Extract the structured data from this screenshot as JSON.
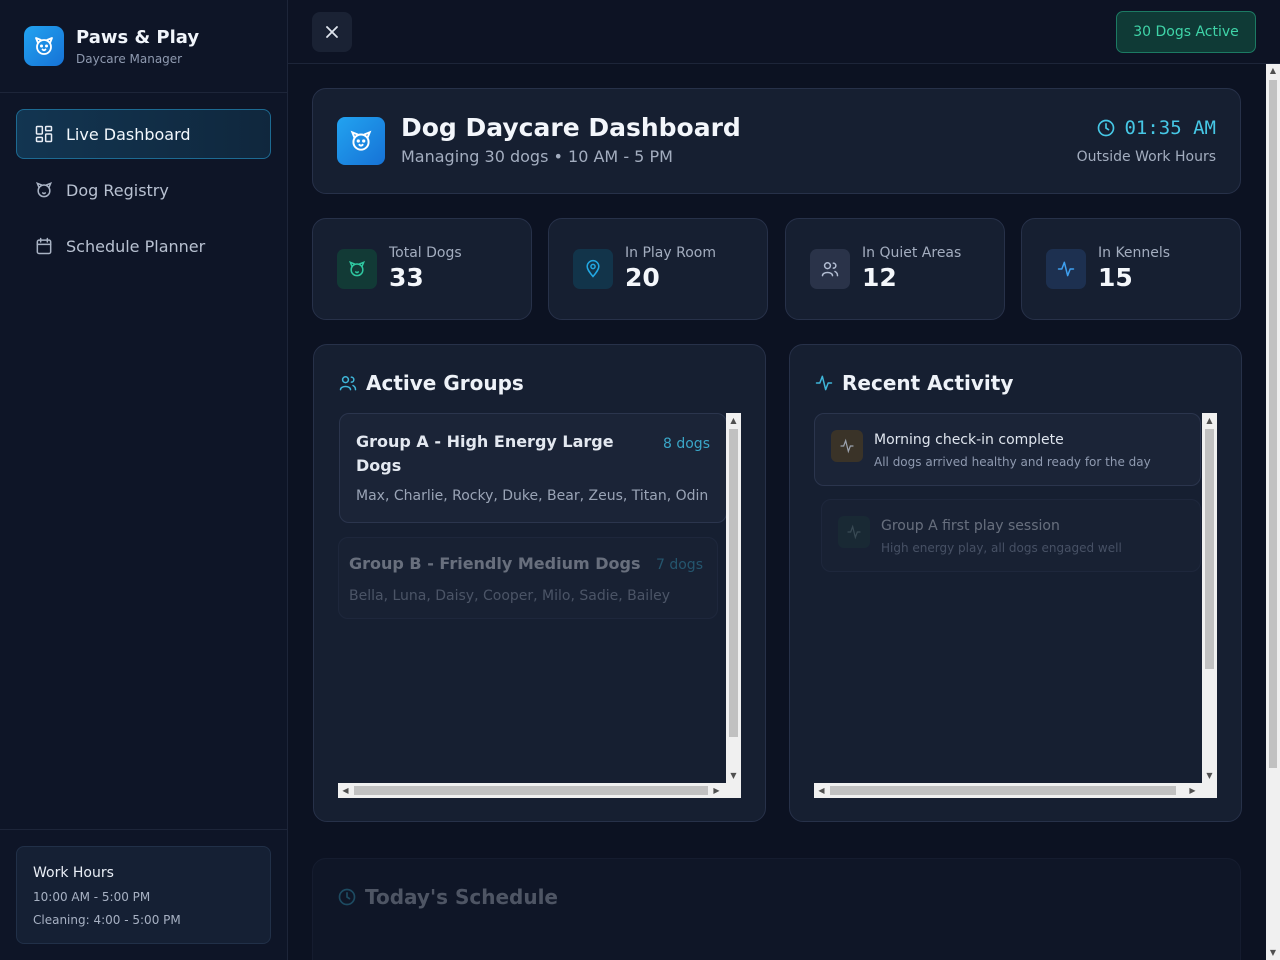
{
  "brand": {
    "title": "Paws & Play",
    "subtitle": "Daycare Manager",
    "logo_icon": "dog-icon"
  },
  "sidebar": {
    "items": [
      {
        "label": "Live Dashboard",
        "icon": "dashboard-grid-icon",
        "active": true
      },
      {
        "label": "Dog Registry",
        "icon": "dog-icon",
        "active": false
      },
      {
        "label": "Schedule Planner",
        "icon": "calendar-icon",
        "active": false
      }
    ],
    "work_hours": {
      "title": "Work Hours",
      "hours": "10:00 AM - 5:00 PM",
      "cleaning": "Cleaning: 4:00 - 5:00 PM"
    }
  },
  "topbar": {
    "close_icon": "close-icon",
    "active_badge": "30 Dogs Active"
  },
  "header": {
    "title": "Dog Daycare Dashboard",
    "subtitle": "Managing 30 dogs • 10 AM - 5 PM",
    "time": "01:35 AM",
    "status": "Outside Work Hours"
  },
  "stats": [
    {
      "label": "Total Dogs",
      "value": "33",
      "icon": "dog-icon",
      "color": "#2fc7a0"
    },
    {
      "label": "In Play Room",
      "value": "20",
      "icon": "map-pin-icon",
      "color": "#22a8e3"
    },
    {
      "label": "In Quiet Areas",
      "value": "12",
      "icon": "users-icon",
      "color": "#b2bdd2"
    },
    {
      "label": "In Kennels",
      "value": "15",
      "icon": "activity-icon",
      "color": "#3fa0f0"
    }
  ],
  "groups_panel": {
    "title": "Active Groups",
    "groups": [
      {
        "name": "Group A - High Energy Large Dogs",
        "count": "8 dogs",
        "dogs": "Max, Charlie, Rocky, Duke, Bear, Zeus, Titan, Odin"
      },
      {
        "name": "Group B - Friendly Medium Dogs",
        "count": "7 dogs",
        "dogs": "Bella, Luna, Daisy, Cooper, Milo, Sadie, Bailey"
      }
    ]
  },
  "activity_panel": {
    "title": "Recent Activity",
    "items": [
      {
        "title": "Morning check-in complete",
        "desc": "All dogs arrived healthy and ready for the day",
        "color": "#d49a3a"
      },
      {
        "title": "Group A first play session",
        "desc": "High energy play, all dogs engaged well",
        "color": "#2fc7a0"
      }
    ]
  },
  "schedule": {
    "title": "Today's Schedule"
  }
}
